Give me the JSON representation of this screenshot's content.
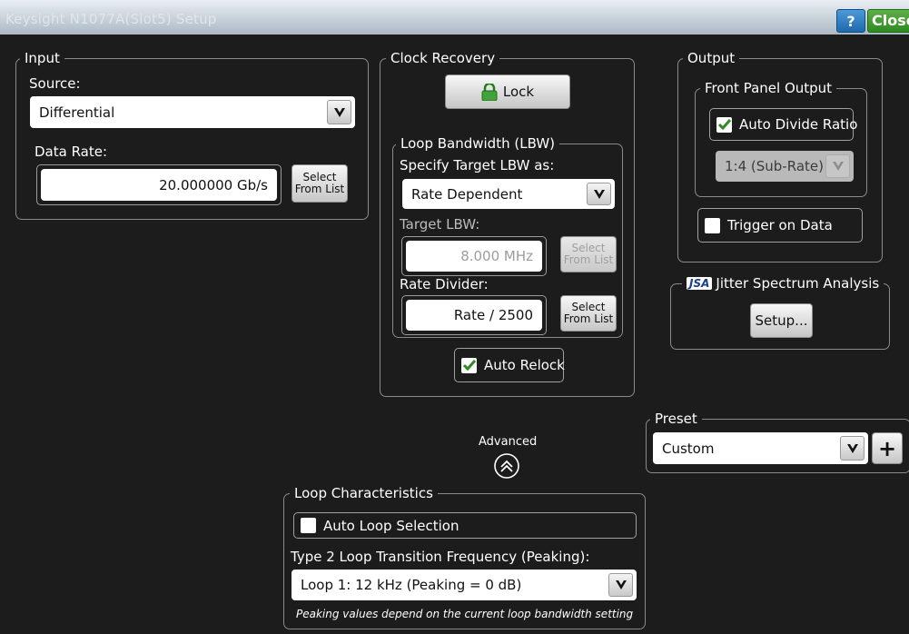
{
  "window": {
    "title": "Keysight N1077A(Slot5) Setup",
    "help_label": "?",
    "close_label": "Close"
  },
  "input": {
    "legend": "Input",
    "source_label": "Source:",
    "source_value": "Differential",
    "data_rate_label": "Data Rate:",
    "data_rate_value": "20.000000 Gb/s",
    "select_line1": "Select",
    "select_line2": "From List"
  },
  "clock_recovery": {
    "legend": "Clock Recovery",
    "lock_label": "Lock",
    "lbw": {
      "legend": "Loop Bandwidth (LBW)",
      "specify_label": "Specify Target LBW as:",
      "specify_value": "Rate Dependent",
      "target_label": "Target LBW:",
      "target_value": "8.000 MHz",
      "rate_divider_label": "Rate Divider:",
      "rate_divider_value": "Rate / 2500",
      "select_line1": "Select",
      "select_line2": "From List"
    },
    "auto_relock_label": "Auto Relock",
    "auto_relock_checked": true
  },
  "output": {
    "legend": "Output",
    "front_panel_legend": "Front Panel Output",
    "auto_divide_label": "Auto Divide Ratio",
    "auto_divide_checked": true,
    "ratio_value": "1:4 (Sub-Rate)",
    "trigger_label": "Trigger on Data",
    "trigger_checked": false
  },
  "jsa": {
    "badge": "JSA",
    "title": "Jitter Spectrum Analysis",
    "setup_label": "Setup..."
  },
  "advanced": {
    "label": "Advanced"
  },
  "preset": {
    "legend": "Preset",
    "value": "Custom",
    "add_label": "+"
  },
  "loop": {
    "legend": "Loop Characteristics",
    "auto_loop_label": "Auto Loop Selection",
    "auto_loop_checked": false,
    "type2_label": "Type 2 Loop Transition Frequency (Peaking):",
    "type2_value": "Loop 1: 12 kHz (Peaking = 0 dB)",
    "note": "Peaking values depend on the current loop bandwidth setting"
  },
  "colors": {
    "accent_green": "#2f8a22",
    "help_blue": "#1f69ad",
    "lock_green": "#3fa33a"
  }
}
